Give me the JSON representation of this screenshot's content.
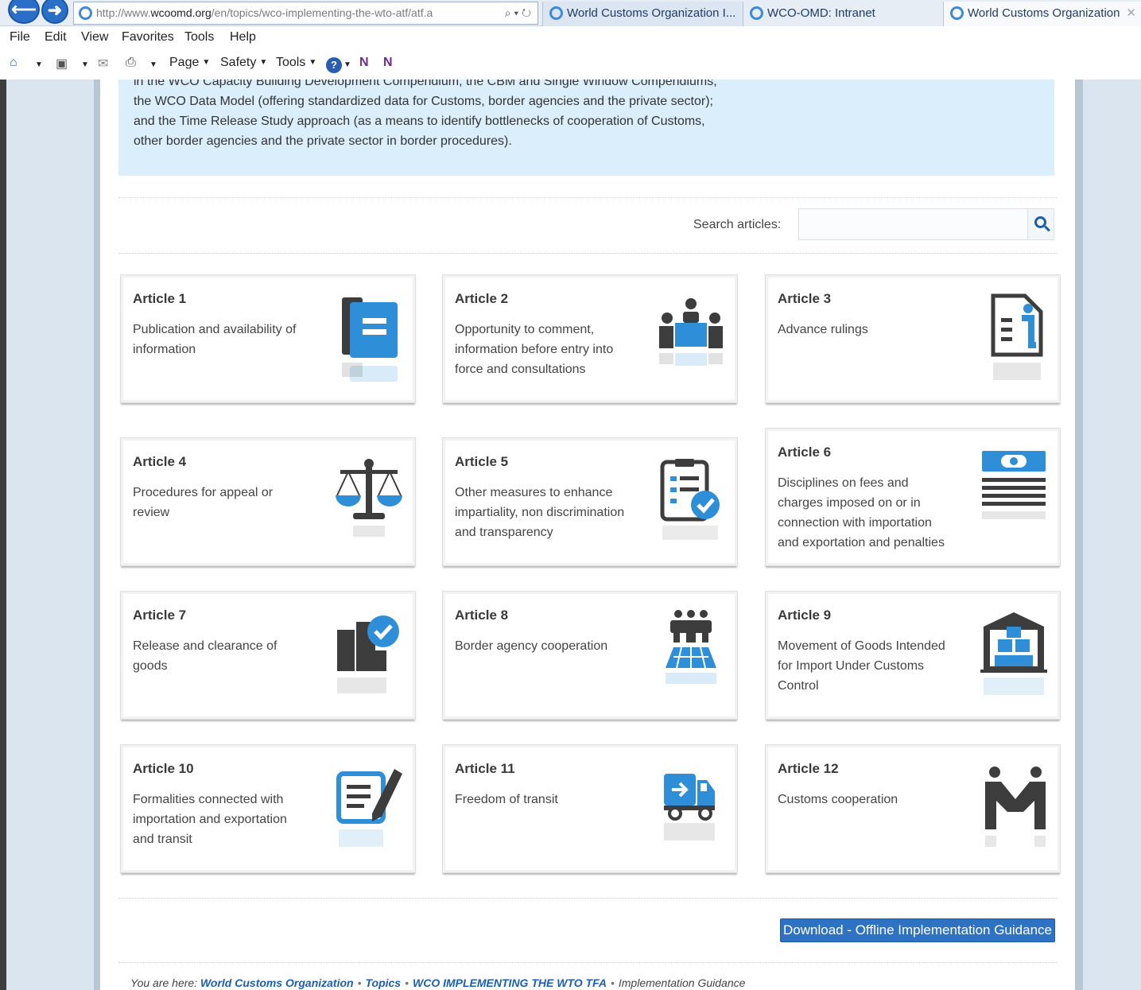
{
  "browser": {
    "url_prefix": "http://www.",
    "url_domain": "wcoomd.org",
    "url_rest": "/en/topics/wco-implementing-the-wto-atf/atf.a",
    "tabs": [
      {
        "label": "World Customs Organization I...",
        "active": true
      },
      {
        "label": "WCO-OMD: Intranet",
        "active": false
      },
      {
        "label": "World Customs Organization",
        "active": false
      }
    ],
    "menu": [
      "File",
      "Edit",
      "View",
      "Favorites",
      "Tools",
      "Help"
    ],
    "commands": {
      "page": "Page",
      "safety": "Safety",
      "tools": "Tools"
    }
  },
  "intro": {
    "lines": [
      "in the WCO Capacity Building Development Compendium, the CBM and Single Window Compendiums,",
      "the WCO Data Model (offering standardized data for Customs, border agencies and the private sector);",
      "and the Time Release Study approach (as a means to identify bottlenecks of cooperation of Customs,",
      "other border agencies and the private sector in border procedures)."
    ]
  },
  "search": {
    "label": "Search articles:",
    "value": ""
  },
  "articles": [
    {
      "title": "Article 1",
      "desc": "Publication and availability of information",
      "icon": "book-icon"
    },
    {
      "title": "Article 2",
      "desc": "Opportunity to comment, information before entry into force and consultations",
      "icon": "meeting-icon"
    },
    {
      "title": "Article 3",
      "desc": "Advance rulings",
      "icon": "info-document-icon"
    },
    {
      "title": "Article 4",
      "desc": "Procedures for appeal or review",
      "icon": "scales-icon"
    },
    {
      "title": "Article 5",
      "desc": "Other measures to enhance impartiality, non discrimination and transparency",
      "icon": "checklist-icon"
    },
    {
      "title": "Article 6",
      "desc": "Disciplines on fees and charges imposed on or in connection with importation and exportation and penalties",
      "icon": "banknote-icon"
    },
    {
      "title": "Article 7",
      "desc": "Release and clearance of goods",
      "icon": "cleared-goods-icon"
    },
    {
      "title": "Article 8",
      "desc": "Border agency cooperation",
      "icon": "agency-group-icon"
    },
    {
      "title": "Article 9",
      "desc": "Movement of Goods Intended for Import Under Customs Control",
      "icon": "warehouse-icon"
    },
    {
      "title": "Article 10",
      "desc": "Formalities connected with importation and exportation and transit",
      "icon": "form-pen-icon"
    },
    {
      "title": "Article 11",
      "desc": "Freedom of transit",
      "icon": "truck-icon"
    },
    {
      "title": "Article 12",
      "desc": "Customs cooperation",
      "icon": "handshake-people-icon"
    }
  ],
  "download_label": "Download - Offline Implementation Guidance",
  "breadcrumb": {
    "prefix": "You are here:",
    "items": [
      "World Customs Organization",
      "Topics",
      "WCO IMPLEMENTING THE WTO TFA"
    ],
    "current": "Implementation Guidance"
  },
  "colors": {
    "accent": "#2e72c4",
    "intro_bg": "#dbeefc",
    "icon_blue": "#2e8fd8",
    "icon_dark": "#3d3d3d"
  }
}
